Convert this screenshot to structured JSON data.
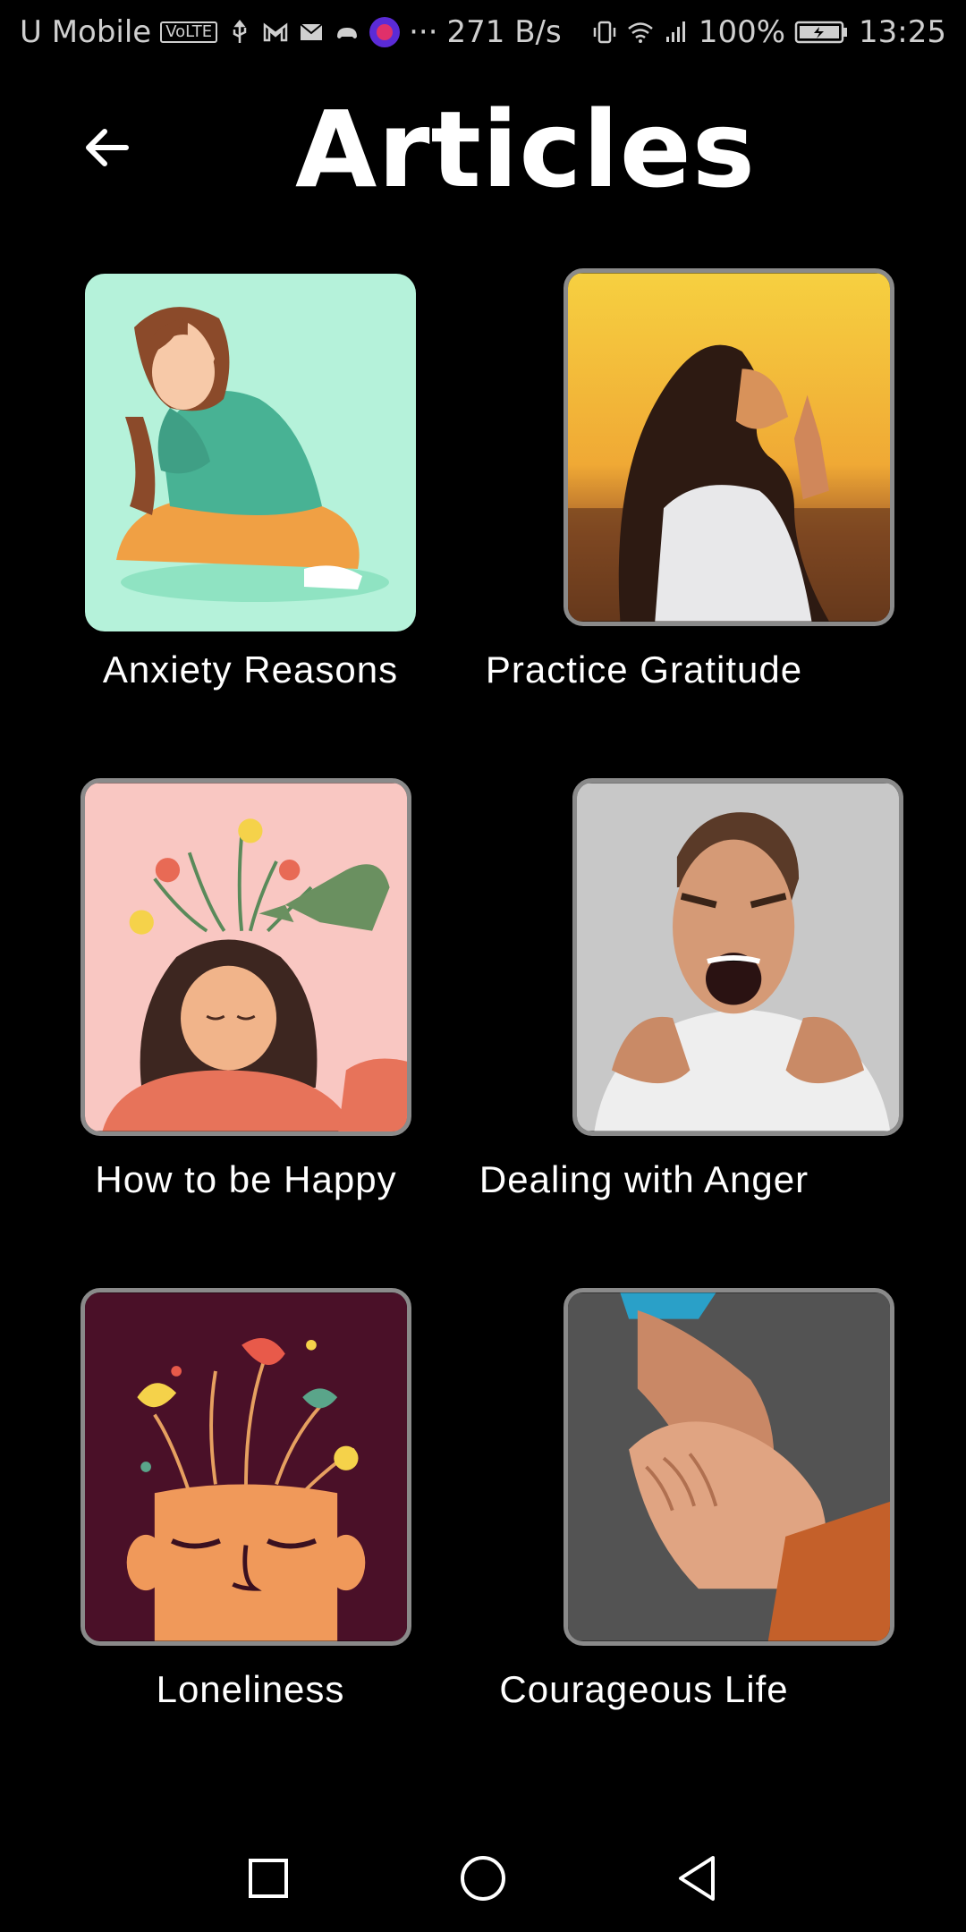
{
  "status_bar": {
    "carrier": "U Mobile",
    "volte": "VoLTE",
    "data_rate": "271 B/s",
    "battery": "100%",
    "time": "13:25",
    "dots": "···"
  },
  "header": {
    "title": "Articles",
    "back_icon": "arrow-left-icon"
  },
  "articles": [
    {
      "title": "Anxiety Reasons"
    },
    {
      "title": "Practice Gratitude"
    },
    {
      "title": "How to be Happy"
    },
    {
      "title": "Dealing with Anger"
    },
    {
      "title": "Loneliness"
    },
    {
      "title": "Courageous Life"
    }
  ],
  "nav_bar": {
    "recent_icon": "square-recents-icon",
    "home_icon": "circle-home-icon",
    "back_icon": "triangle-back-icon"
  },
  "colors": {
    "background": "#000000",
    "text": "#ffffff",
    "thumb_border": "#8a8a8a"
  }
}
